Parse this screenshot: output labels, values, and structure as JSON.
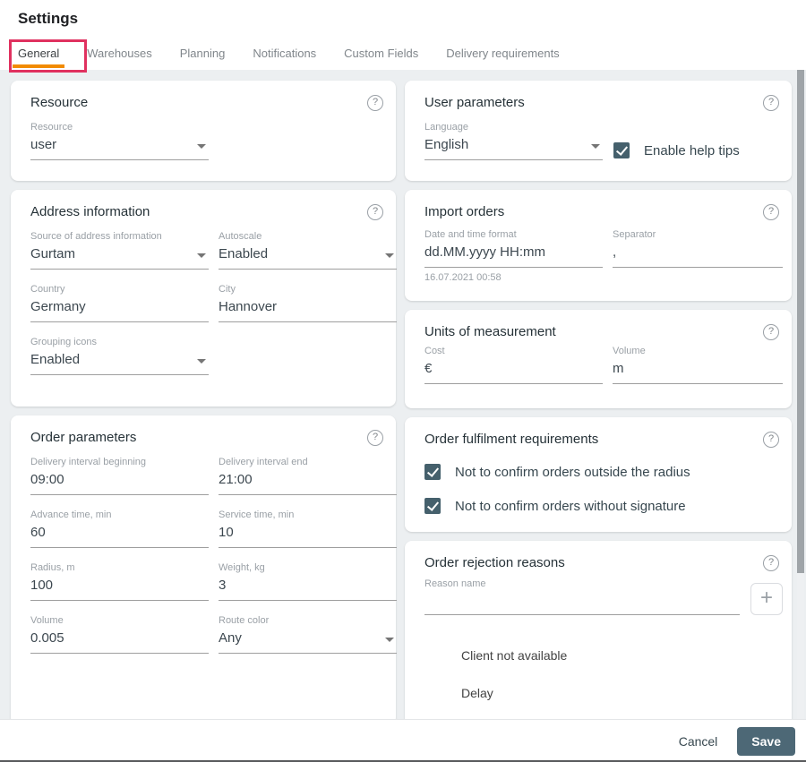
{
  "title": "Settings",
  "icons": {
    "help": "?",
    "add": "+"
  },
  "tabs": [
    {
      "label": "General",
      "active": true
    },
    {
      "label": "Warehouses",
      "active": false
    },
    {
      "label": "Planning",
      "active": false
    },
    {
      "label": "Notifications",
      "active": false
    },
    {
      "label": "Custom Fields",
      "active": false
    },
    {
      "label": "Delivery requirements",
      "active": false
    }
  ],
  "cards": {
    "resource": {
      "title": "Resource",
      "resource_label": "Resource",
      "resource_value": "user"
    },
    "address": {
      "title": "Address information",
      "source_label": "Source of address information",
      "source_value": "Gurtam",
      "autoscale_label": "Autoscale",
      "autoscale_value": "Enabled",
      "country_label": "Country",
      "country_value": "Germany",
      "city_label": "City",
      "city_value": "Hannover",
      "grouping_label": "Grouping icons",
      "grouping_value": "Enabled"
    },
    "order_params": {
      "title": "Order parameters",
      "fields": [
        {
          "label": "Delivery interval beginning",
          "value": "09:00"
        },
        {
          "label": "Delivery interval end",
          "value": "21:00"
        },
        {
          "label": "Advance time, min",
          "value": "60"
        },
        {
          "label": "Service time, min",
          "value": "10"
        },
        {
          "label": "Radius, m",
          "value": "100"
        },
        {
          "label": "Weight, kg",
          "value": "3"
        },
        {
          "label": "Volume",
          "value": "0.005"
        },
        {
          "label": "Route color",
          "value": "Any"
        }
      ]
    },
    "user_params": {
      "title": "User parameters",
      "language_label": "Language",
      "language_value": "English",
      "help_tips_label": "Enable help tips",
      "help_tips_checked": true
    },
    "import_orders": {
      "title": "Import orders",
      "datetime_label": "Date and time format",
      "datetime_value": "dd.MM.yyyy HH:mm",
      "datetime_hint": "16.07.2021 00:58",
      "separator_label": "Separator",
      "separator_value": ","
    },
    "units": {
      "title": "Units of measurement",
      "cost_label": "Cost",
      "cost_value": "€",
      "volume_label": "Volume",
      "volume_value": "m"
    },
    "fulfilment": {
      "title": "Order fulfilment requirements",
      "options": [
        {
          "label": "Not to confirm orders outside the radius",
          "checked": true
        },
        {
          "label": "Not to confirm orders without signature",
          "checked": true
        }
      ]
    },
    "rejection": {
      "title": "Order rejection reasons",
      "reason_label": "Reason name",
      "reason_value": "",
      "reasons": [
        "Client not available",
        "Delay"
      ]
    }
  },
  "footer": {
    "cancel": "Cancel",
    "save": "Save"
  },
  "colors": {
    "accent_orange": "#F28B00",
    "annotation_red": "#E0315F",
    "checkbox": "#45606C",
    "save_bg": "#4D6876",
    "page_bg": "#ECEFF1"
  }
}
